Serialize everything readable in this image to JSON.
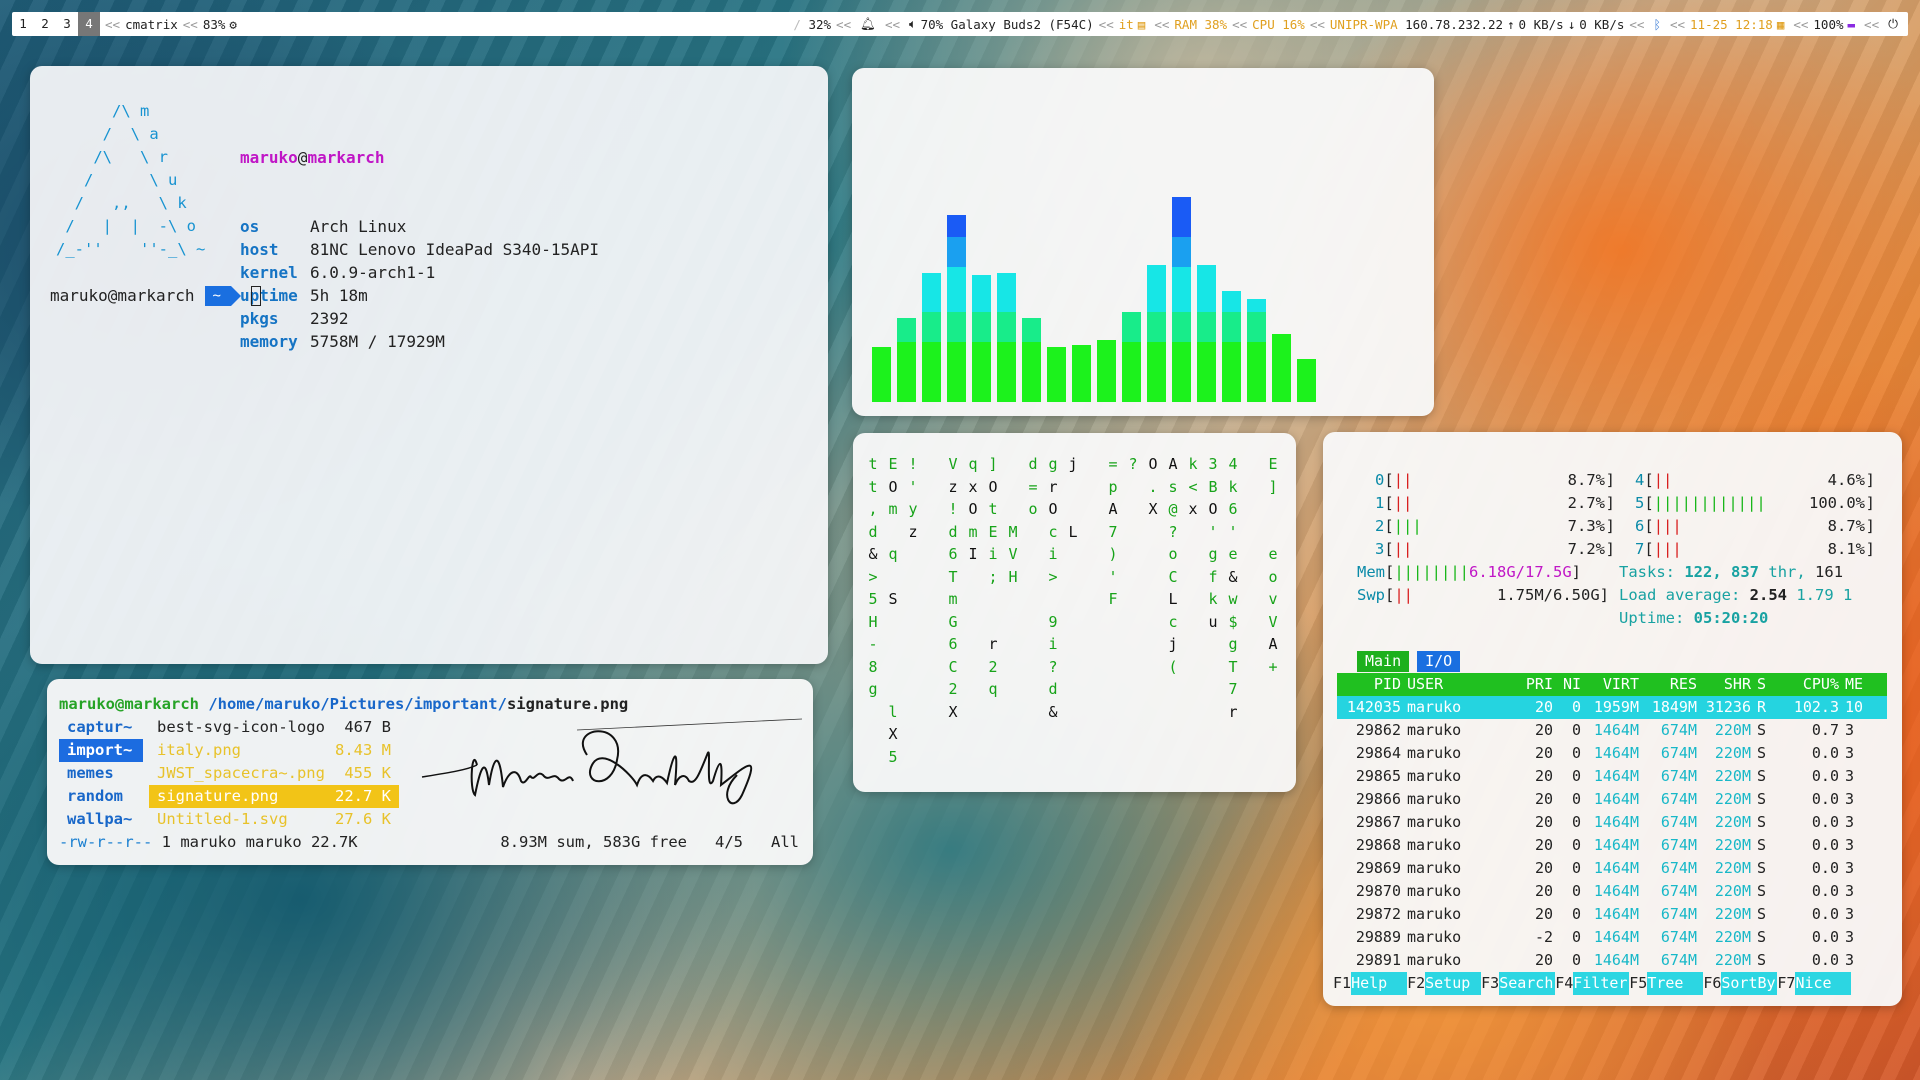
{
  "bar": {
    "workspaces": [
      "1",
      "2",
      "3",
      "4"
    ],
    "active_workspace": "4",
    "window_title": "cmatrix",
    "title_pct": "83%",
    "left_sep": "<<",
    "brightness": "32%",
    "volume": "70%",
    "bluetooth_device": "Galaxy Buds2 (F54C)",
    "keyboard_layout": "it",
    "ram": "RAM 38%",
    "cpu": "CPU 16%",
    "network_name": "UNIPR-WPA",
    "ip": "160.78.232.22",
    "up_speed": "0 KB/s",
    "down_speed": "0 KB/s",
    "datetime": "11-25 12:18",
    "battery": "100%",
    "sep": "<<",
    "sep2": "/"
  },
  "neofetch": {
    "logo_lines": [
      "      /\\ m",
      "     /  \\ a",
      "    /\\   \\ r",
      "   /      \\ u",
      "  /   ,,   \\ k",
      " /   |  |  -\\ o",
      "/_-''    ''-_\\ ~"
    ],
    "user": "maruko",
    "at": "@",
    "host_name": "markarch",
    "fields": [
      {
        "k": "os",
        "v": "Arch Linux"
      },
      {
        "k": "host",
        "v": "81NC Lenovo IdeaPad S340-15API"
      },
      {
        "k": "kernel",
        "v": "6.0.9-arch1-1"
      },
      {
        "k": "uptime",
        "v": "5h 18m"
      },
      {
        "k": "pkgs",
        "v": "2392"
      },
      {
        "k": "memory",
        "v": "5758M / 17929M"
      }
    ],
    "prompt_user": "maruko@markarch",
    "prompt_dir": "~"
  },
  "cava": {
    "levels": [
      0.27,
      0.41,
      0.63,
      0.91,
      0.62,
      0.63,
      0.41,
      0.27,
      0.28,
      0.3,
      0.44,
      0.67,
      1.0,
      0.67,
      0.54,
      0.5,
      0.33,
      0.21
    ],
    "colors": {
      "bottom": "#1cf21c",
      "mid": "#17e6e6",
      "top": "#1a5bf5"
    }
  },
  "matrix": {
    "columns": [
      "ttxd&>5H-8g",
      "EO,q S",
      " !mz",
      " y ",
      "V!zd6TmG6C25,/",
      "qxOm",
      "] Ot ",
      "Oti;rM2q",
      "dEVH",
      "gr=MOci>",
      "jLo ",
      "  O9i?d&t",
      "=pA7)'F",
      "?",
      "OA.X",
      "As<@?oCLcj(",
      "k X",
      "3BOg&k$uVr",
      "4k6 ",
      "' eew7T",
      "E]o vVA+"
    ],
    "cols_data": [
      {
        "c": "t t , d & > 5 H - 8 g"
      },
      {
        "c": "E O m q S"
      },
      {
        "c": "! ' y z"
      }
    ]
  },
  "htop": {
    "cpus": [
      {
        "id": "0",
        "bar": "||",
        "pct": "8.7%"
      },
      {
        "id": "1",
        "bar": "||",
        "pct": "2.7%"
      },
      {
        "id": "2",
        "bar": "|||",
        "pct": "7.3%"
      },
      {
        "id": "3",
        "bar": "||",
        "pct": "7.2%"
      },
      {
        "id": "4",
        "bar": "||",
        "pct": "4.6%"
      },
      {
        "id": "5",
        "bar": "||||||||||||",
        "pct": "100.0%"
      },
      {
        "id": "6",
        "bar": "|||",
        "pct": "8.7%"
      },
      {
        "id": "7",
        "bar": "|||",
        "pct": "8.1%"
      }
    ],
    "mem_label": "Mem",
    "mem_bar": "||||||||",
    "mem_val": "6.18G/17.5G",
    "swp_label": "Swp",
    "swp_bar": "||",
    "swp_val": "1.75M/6.50G",
    "tasks_label": "Tasks:",
    "tasks": "122,",
    "threads": "837",
    "thr_label": "thr,",
    "running": "161",
    "load_label": "Load average:",
    "load1": "2.54",
    "load5": "1.79",
    "load15": "1",
    "uptime_label": "Uptime:",
    "uptime": "05:20:20",
    "tabs": [
      "Main",
      "I/O"
    ],
    "header": [
      "PID",
      "USER",
      "PRI",
      "NI",
      "VIRT",
      "RES",
      "SHR",
      "S",
      "CPU%",
      "ME"
    ],
    "rows": [
      [
        "142035",
        "maruko",
        "20",
        "0",
        "1959M",
        "1849M",
        "31236",
        "R",
        "102.3",
        "10"
      ],
      [
        "29862",
        "maruko",
        "20",
        "0",
        "1464M",
        "674M",
        "220M",
        "S",
        "0.7",
        "3"
      ],
      [
        "29864",
        "maruko",
        "20",
        "0",
        "1464M",
        "674M",
        "220M",
        "S",
        "0.0",
        "3"
      ],
      [
        "29865",
        "maruko",
        "20",
        "0",
        "1464M",
        "674M",
        "220M",
        "S",
        "0.0",
        "3"
      ],
      [
        "29866",
        "maruko",
        "20",
        "0",
        "1464M",
        "674M",
        "220M",
        "S",
        "0.0",
        "3"
      ],
      [
        "29867",
        "maruko",
        "20",
        "0",
        "1464M",
        "674M",
        "220M",
        "S",
        "0.0",
        "3"
      ],
      [
        "29868",
        "maruko",
        "20",
        "0",
        "1464M",
        "674M",
        "220M",
        "S",
        "0.0",
        "3"
      ],
      [
        "29869",
        "maruko",
        "20",
        "0",
        "1464M",
        "674M",
        "220M",
        "S",
        "0.0",
        "3"
      ],
      [
        "29870",
        "maruko",
        "20",
        "0",
        "1464M",
        "674M",
        "220M",
        "S",
        "0.0",
        "3"
      ],
      [
        "29872",
        "maruko",
        "20",
        "0",
        "1464M",
        "674M",
        "220M",
        "S",
        "0.0",
        "3"
      ],
      [
        "29889",
        "maruko",
        "-2",
        "0",
        "1464M",
        "674M",
        "220M",
        "S",
        "0.0",
        "3"
      ],
      [
        "29891",
        "maruko",
        "20",
        "0",
        "1464M",
        "674M",
        "220M",
        "S",
        "0.0",
        "3"
      ]
    ],
    "fkeys": [
      {
        "k": "F1",
        "l": "Help"
      },
      {
        "k": "F2",
        "l": "Setup"
      },
      {
        "k": "F3",
        "l": "Search"
      },
      {
        "k": "F4",
        "l": "Filter"
      },
      {
        "k": "F5",
        "l": "Tree"
      },
      {
        "k": "F6",
        "l": "SortBy"
      },
      {
        "k": "F7",
        "l": "Nice"
      }
    ]
  },
  "ranger": {
    "user_host": "maruko@markarch",
    "path": "/home/maruko/Pictures/important/",
    "file": "signature.png",
    "left": [
      "captur~",
      "import~",
      "memes",
      "random",
      "wallpa~"
    ],
    "left_selected": 1,
    "files": [
      {
        "name": "best-svg-icon-logo",
        "size": "467 B"
      },
      {
        "name": "italy.png",
        "size": "8.43 M"
      },
      {
        "name": "JWST_spacecra~.png",
        "size": "455 K"
      },
      {
        "name": "signature.png",
        "size": "22.7 K"
      },
      {
        "name": "Untitled-1.svg",
        "size": "27.6 K"
      }
    ],
    "file_selected": 3,
    "perm": "-rw-r--r--",
    "info": "1 maruko maruko 22.7K",
    "summary": "8.93M sum, 583G free",
    "pos": "4/5",
    "all": "All"
  }
}
